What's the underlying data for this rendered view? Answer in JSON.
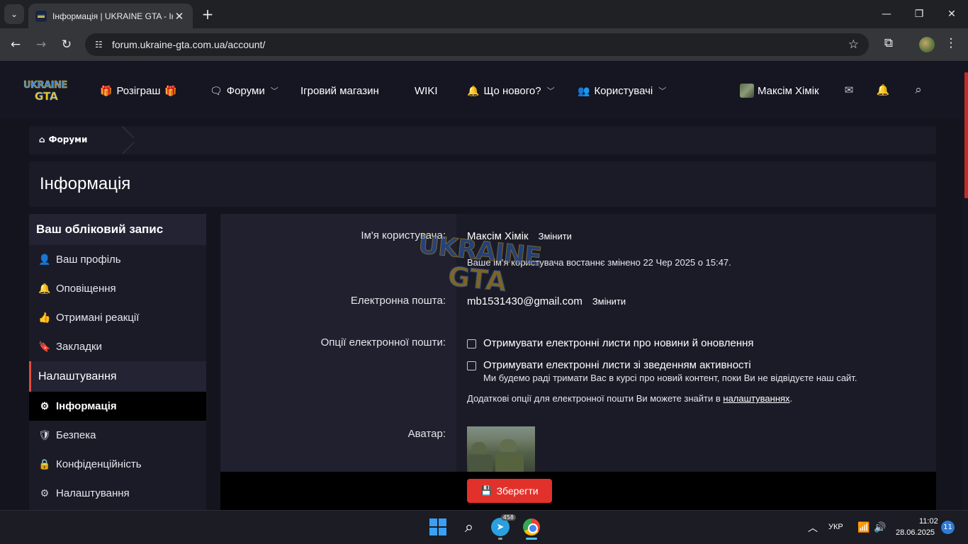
{
  "browser": {
    "tab_title": "Інформація | UKRAINE GTA - Інформація",
    "tab_close": "✕",
    "new_tab": "+",
    "url": "forum.ukraine-gta.com.ua/account/",
    "window_controls": [
      "—",
      "❐",
      "✕"
    ]
  },
  "site": {
    "logo_line1": "UKRAINE",
    "logo_line2": "GTA",
    "nav": [
      {
        "label": "Розіграш",
        "icon": "gift-icon"
      },
      {
        "label": "Форуми",
        "icon": "comment-icon"
      },
      {
        "label": "Ігровий магазин"
      },
      {
        "label": "WIKI"
      },
      {
        "label": "Що нового?",
        "icon": "bell-icon"
      },
      {
        "label": "Користувачі",
        "icon": "users-icon"
      }
    ],
    "user_name": "Максім Хімік"
  },
  "breadcrumb": {
    "home": "Форуми"
  },
  "page_title": "Інформація",
  "sidebar": {
    "heading": "Ваш обліковий запис",
    "items": [
      {
        "label": "Ваш профіль",
        "icon": "user-icon"
      },
      {
        "label": "Оповіщення",
        "icon": "bell-icon"
      },
      {
        "label": "Отримані реакції",
        "icon": "thumbs-up-icon"
      },
      {
        "label": "Закладки",
        "icon": "bookmark-icon"
      }
    ],
    "section": "Налаштування",
    "settings_items": [
      {
        "label": "Інформація",
        "icon": "user-cog-icon",
        "active": true
      },
      {
        "label": "Безпека",
        "icon": "shield-icon"
      },
      {
        "label": "Конфіденційність",
        "icon": "lock-icon"
      },
      {
        "label": "Налаштування",
        "icon": "cogs-icon"
      }
    ]
  },
  "form": {
    "username_label": "Ім'я користувача:",
    "username_value": "Максім Хімік",
    "change_label": "Змінити",
    "username_hint": "Ваше ім'я користувача востаннє змінено 22 Чер 2025 о 15:47.",
    "email_label": "Електронна пошта:",
    "email_value": "mb1531430@gmail.com",
    "email_options_label": "Опції електронної пошти:",
    "opt1": "Отримувати електронні листи про новини й оновлення",
    "opt2": "Отримувати електронні листи зі зведенням активності",
    "opt2_hint": "Ми будемо раді тримати Вас в курсі про новий контент, поки Ви не відвідуєте наш сайт.",
    "extra_prefix": "Додаткові опції для електронної пошти Ви можете знайти в ",
    "extra_link": "налаштуваннях",
    "extra_suffix": ".",
    "avatar_label": "Аватар:",
    "save_label": "Зберегти"
  },
  "taskbar": {
    "telegram_badge": "458",
    "lang": "УКР",
    "time": "11:02",
    "date": "28.06.2025",
    "notifications": "11"
  }
}
